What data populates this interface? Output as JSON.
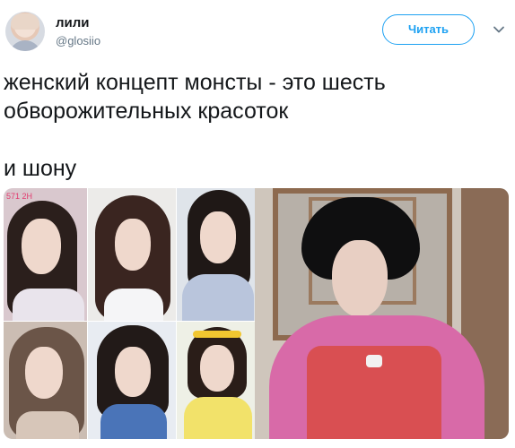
{
  "tweet": {
    "author_name": "лили",
    "author_handle": "@glosiio",
    "follow_label": "Читать",
    "text": "женский концепт монсты - это шесть обворожительных красоток\n\nи шону",
    "corner_stamp": "571 2H"
  },
  "icons": {
    "menu": "chevron-down-icon"
  },
  "colors": {
    "accent": "#1da1f2",
    "handle": "#657786",
    "text": "#14171a"
  }
}
